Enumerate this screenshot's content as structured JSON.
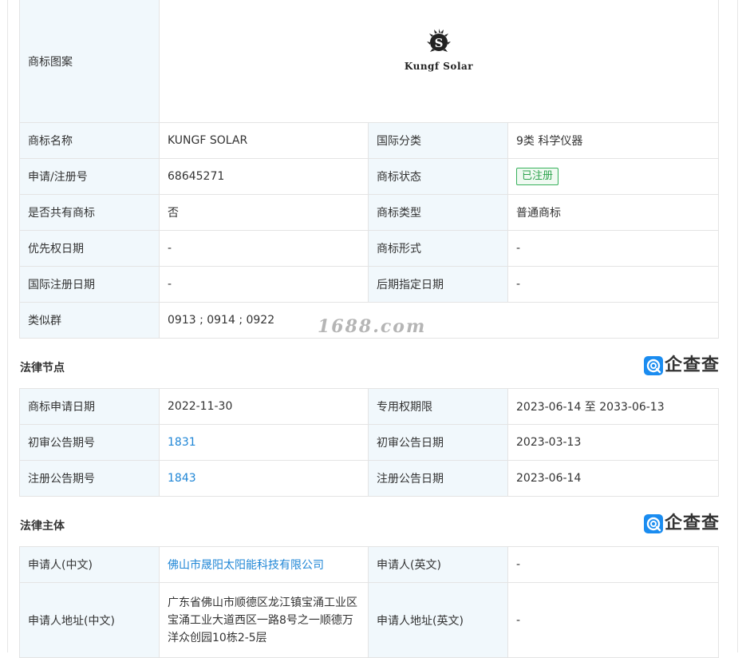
{
  "trademark": {
    "logo_label": "商标图案",
    "logo_text": "Kungf Solar",
    "rows": [
      {
        "k1": "商标名称",
        "v1": "KUNGF SOLAR",
        "k2": "国际分类",
        "v2": "9类 科学仪器"
      },
      {
        "k1": "申请/注册号",
        "v1": "68645271",
        "k2": "商标状态",
        "v2": "已注册"
      },
      {
        "k1": "是否共有商标",
        "v1": "否",
        "k2": "商标类型",
        "v2": "普通商标"
      },
      {
        "k1": "优先权日期",
        "v1": "-",
        "k2": "商标形式",
        "v2": "-"
      },
      {
        "k1": "国际注册日期",
        "v1": "-",
        "k2": "后期指定日期",
        "v2": "-"
      }
    ],
    "similar_group_label": "类似群",
    "similar_group_value": "0913 ; 0914 ; 0922",
    "status_color": "#37b15b"
  },
  "legal_nodes": {
    "title": "法律节点",
    "rows": [
      {
        "k1": "商标申请日期",
        "v1": "2022-11-30",
        "k2": "专用权期限",
        "v2": "2023-06-14 至 2033-06-13"
      },
      {
        "k1": "初审公告期号",
        "v1": "1831",
        "k2": "初审公告日期",
        "v2": "2023-03-13"
      },
      {
        "k1": "注册公告期号",
        "v1": "1843",
        "k2": "注册公告日期",
        "v2": "2023-06-14"
      }
    ]
  },
  "legal_subject": {
    "title": "法律主体",
    "rows": [
      {
        "k1": "申请人(中文)",
        "v1": "佛山市晟阳太阳能科技有限公司",
        "k2": "申请人(英文)",
        "v2": "-"
      },
      {
        "k1": "申请人地址(中文)",
        "v1": "广东省佛山市顺德区龙江镇宝涌工业区宝涌工业大道西区一路8号之一顺德万洋众创园10栋2-5层",
        "k2": "申请人地址(英文)",
        "v2": "-"
      }
    ]
  },
  "brand": {
    "name": "企查查",
    "icon": "qichacha-logo-icon",
    "color": "#1a8cf0"
  },
  "watermark": "1688.com",
  "link_color": "#1f86d6"
}
